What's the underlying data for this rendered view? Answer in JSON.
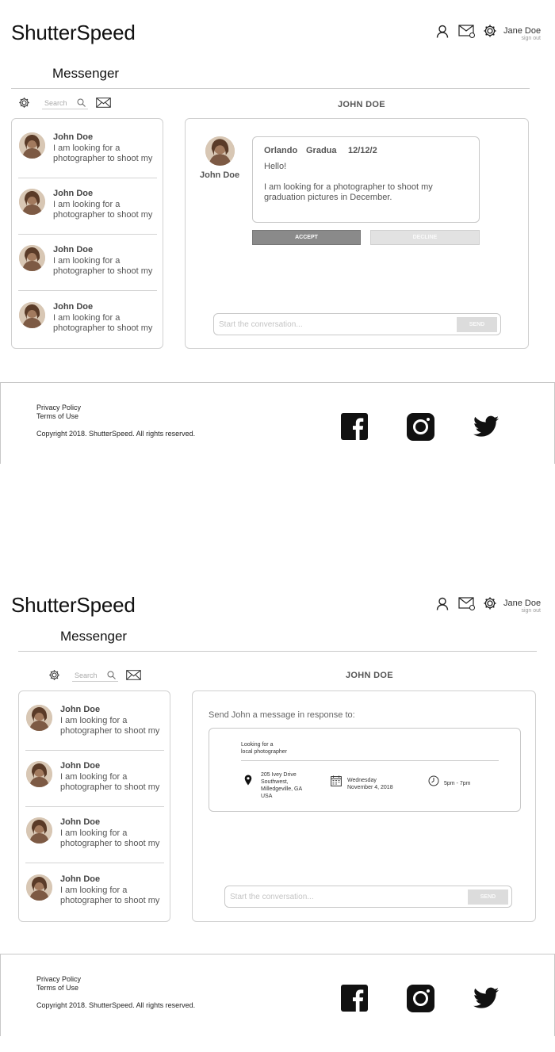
{
  "brand": "ShutterSpeed",
  "page_title": "Messenger",
  "user": {
    "name": "Jane Doe",
    "sign_out": "sign out"
  },
  "toolbar": {
    "search_placeholder": "Search"
  },
  "conversation_header": "JOHN DOE",
  "conversations": [
    {
      "name": "John Doe",
      "preview_line1": "I am looking for a",
      "preview_line2": "photographer to shoot my"
    },
    {
      "name": "John Doe",
      "preview_line1": "I am looking for a",
      "preview_line2": "photographer to shoot my"
    },
    {
      "name": "John Doe",
      "preview_line1": "I am looking for a",
      "preview_line2": "photographer to shoot my"
    },
    {
      "name": "John Doe",
      "preview_line1": "I am looking for a",
      "preview_line2": "photographer to shoot my"
    }
  ],
  "request": {
    "sender": "John Doe",
    "location": "Orlando",
    "type": "Gradua",
    "date": "12/12/2",
    "greeting": "Hello!",
    "body_line1": "I am looking for a photographer to shoot my",
    "body_line2": "graduation pictures in December.",
    "accept_label": "ACCEPT",
    "decline_label": "DECLINE"
  },
  "compose": {
    "placeholder": "Start the conversation...",
    "send_label": "SEND"
  },
  "response_view": {
    "label": "Send John a message in response to:",
    "job_title_line1": "Looking for a",
    "job_title_line2": "local photographer",
    "address_line1": "205 Ivey Drive",
    "address_line2": "Southwest,",
    "address_line3": "Milledgeville, GA",
    "address_line4": "USA",
    "date_line1": "Wednesday",
    "date_line2": "November 4, 2018",
    "time": "5pm - 7pm"
  },
  "footer": {
    "privacy": "Privacy Policy",
    "terms": "Terms of Use",
    "copyright": "Copyright 2018. ShutterSpeed. All rights reserved."
  },
  "icons": {
    "profile": "user-icon",
    "messages": "mail-icon",
    "settings": "gear-icon",
    "search": "search-icon",
    "compose": "compose-mail-icon",
    "facebook": "facebook-icon",
    "instagram": "instagram-icon",
    "twitter": "twitter-icon",
    "location": "location-pin-icon",
    "calendar": "calendar-icon",
    "clock": "clock-icon"
  },
  "colors": {
    "accept_button": "#8a8a8a",
    "decline_button": "#e2e2e2",
    "send_button": "#dcdcdc",
    "border": "#c8c8c8"
  }
}
